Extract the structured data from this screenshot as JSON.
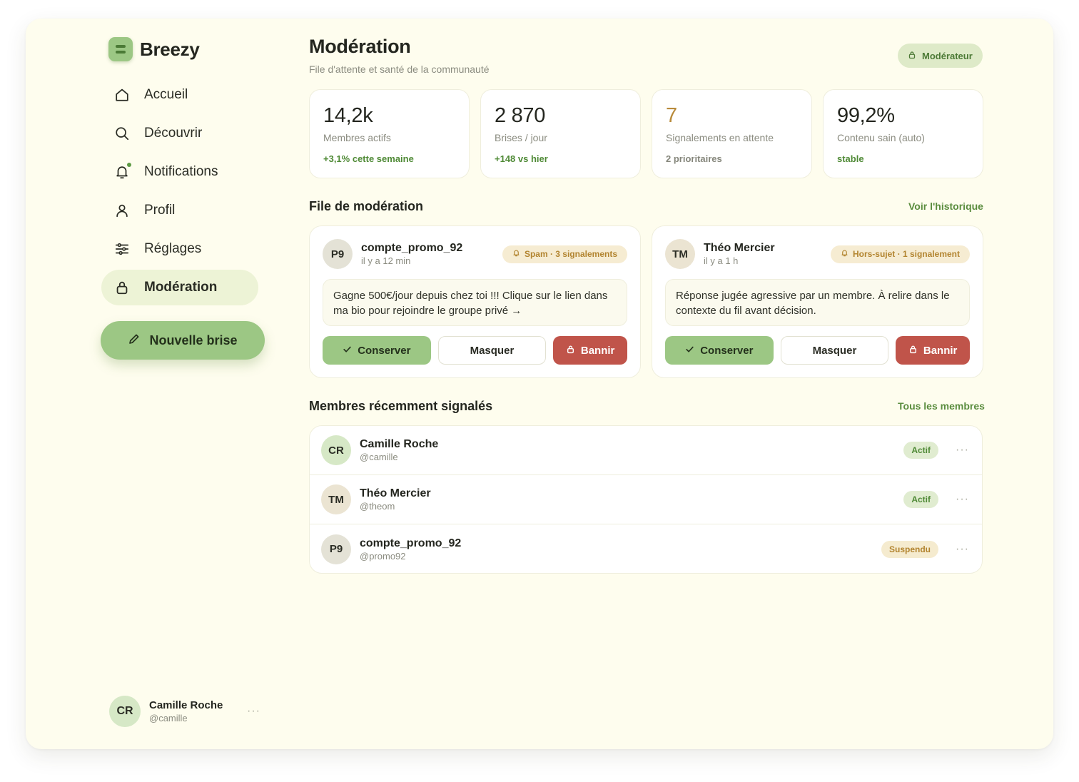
{
  "brand": {
    "name": "Breezy"
  },
  "nav": {
    "items": [
      {
        "label": "Accueil",
        "icon": "home-icon"
      },
      {
        "label": "Découvrir",
        "icon": "search-icon"
      },
      {
        "label": "Notifications",
        "icon": "bell-icon"
      },
      {
        "label": "Profil",
        "icon": "user-icon"
      },
      {
        "label": "Réglages",
        "icon": "sliders-icon"
      },
      {
        "label": "Modération",
        "icon": "lock-icon"
      }
    ],
    "active": "Modération"
  },
  "new_post": {
    "label": "Nouvelle brise"
  },
  "current_user": {
    "initials": "CR",
    "name": "Camille Roche",
    "handle": "@camille",
    "more": "···"
  },
  "header": {
    "title": "Modération",
    "subtitle": "File d'attente et santé de la communauté",
    "role_badge": "Modérateur"
  },
  "stats": [
    {
      "value": "14,2k",
      "label": "Membres actifs",
      "delta": "+3,1% cette semaine"
    },
    {
      "value": "2 870",
      "label": "Brises / jour",
      "delta": "+148 vs hier"
    },
    {
      "value": "7",
      "label": "Signalements en attente",
      "delta": "2 prioritaires"
    },
    {
      "value": "99,2%",
      "label": "Contenu sain (auto)",
      "delta": "stable"
    }
  ],
  "queue": {
    "title": "File de modération",
    "link": "Voir l'historique",
    "items": [
      {
        "initials": "P9",
        "name": "compte_promo_92",
        "time": "il y a 12 min",
        "flag": "Spam · 3 signalements",
        "text": "Gagne 500€/jour depuis chez toi !!! Clique sur le lien dans ma bio pour rejoindre le groupe privé →",
        "keep": "Conserver",
        "hide": "Masquer",
        "ban": "Bannir"
      },
      {
        "initials": "TM",
        "name": "Théo Mercier",
        "time": "il y a 1 h",
        "flag": "Hors-sujet · 1 signalement",
        "text": "Réponse jugée agressive par un membre. À relire dans le contexte du fil avant décision.",
        "keep": "Conserver",
        "hide": "Masquer",
        "ban": "Bannir"
      }
    ]
  },
  "members": {
    "title": "Membres récemment signalés",
    "link": "Tous les membres",
    "rows": [
      {
        "initials": "CR",
        "name": "Camille Roche",
        "handle": "@camille",
        "status": "Actif",
        "more": "···"
      },
      {
        "initials": "TM",
        "name": "Théo Mercier",
        "handle": "@theom",
        "status": "Actif",
        "more": "···"
      },
      {
        "initials": "P9",
        "name": "compte_promo_92",
        "handle": "@promo92",
        "status": "Suspendu",
        "more": "···"
      }
    ]
  },
  "colors": {
    "background": "#fefdee",
    "accent": "#9cc784",
    "accent_text": "#4f8a36",
    "warning": "#b88a3a",
    "danger": "#c0544a"
  }
}
